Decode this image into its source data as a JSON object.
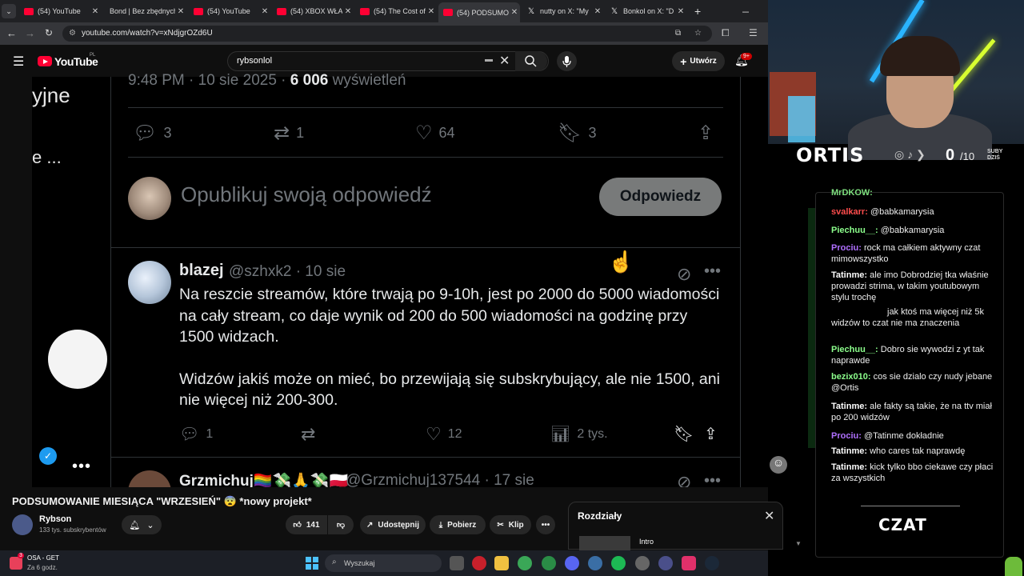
{
  "browser": {
    "tabs": [
      {
        "label": "(54) YouTube",
        "icon": "youtube-icon"
      },
      {
        "label": "Bond | Bez zbędnych",
        "icon": "none"
      },
      {
        "label": "(54) YouTube",
        "icon": "youtube-icon"
      },
      {
        "label": "(54) XBOX WŁA",
        "icon": "youtube-icon"
      },
      {
        "label": "(54) The Cost of",
        "icon": "youtube-icon"
      },
      {
        "label": "(54) PODSUMO",
        "icon": "youtube-icon",
        "active": true
      },
      {
        "label": "nutty on X: \"My",
        "icon": "x-icon"
      },
      {
        "label": "Bonkol on X: \"D",
        "icon": "x-icon"
      }
    ],
    "url": "youtube.com/watch?v=xNdjgrOZd6U",
    "new_tab": "+"
  },
  "youtube": {
    "logo_text": "YouTube",
    "logo_region": "PL",
    "search_value": "rybsonlol",
    "create_label": "Utwórz",
    "notifications_badge": "9+"
  },
  "video": {
    "left_text_1": "yjne",
    "left_text_2": "e ...",
    "left_dots": "•••",
    "tweet_date_line_prefix": "9:48 PM · 10 sie 2025 · ",
    "tweet_views_number": "6 006",
    "tweet_views_suffix": " wyświetleń",
    "stats": {
      "replies": "3",
      "reposts": "1",
      "likes": "64",
      "bookmarks": "3"
    },
    "reply_placeholder": "Opublikuj swoją odpowiedź",
    "reply_button": "Odpowiedz",
    "reply_tweet": {
      "name": "blazej",
      "handle": "@szhxk2 · 10 sie",
      "paragraph_1": "Na reszcie streamów, które trwają po 9-10h, jest po 2000 do 5000 wiadomości na cały stream, co daje wynik od 200 do 500 wiadomości na godzinę przy 1500 widzach.",
      "paragraph_2": "Widzów jakiś może on mieć, bo przewijają się subskrybujący, ale nie 1500, ani nie więcej niż 200-300.",
      "replies": "1",
      "likes": "12",
      "views": "2 tys."
    },
    "next_tweet": {
      "name": "Grzmichuj🏳️‍🌈💸🙏💸🇵🇱",
      "handle": "@Grzmichuj137544 · 17 sie"
    }
  },
  "below_video": {
    "title": "PODSUMOWANIE MIESIĄCA \"WRZESIEŃ\" 😨 *nowy projekt*",
    "channel_name": "Rybson",
    "channel_subs": "133 tys. subskrybentów",
    "likes": "141",
    "share_label": "Udostępnij",
    "download_label": "Pobierz",
    "clip_label": "Klip",
    "more": "•••"
  },
  "chapters": {
    "title": "Rozdziały",
    "first_item": "Intro"
  },
  "stream_overlay": {
    "streamer": "ORTIS",
    "sub_count": "0",
    "sub_goal": "/10",
    "sub_label_1": "SUBY",
    "sub_label_2": "DZIŚ",
    "chat_title": "CZAT",
    "messages": [
      {
        "user": "MrDKOW:",
        "text": "",
        "color": "#7ee07e"
      },
      {
        "user": "svalkarr:",
        "text": "@babkamarysia",
        "color": "#ff4d4d"
      },
      {
        "user": "Piechuu__:",
        "text": "@babkamarysia",
        "color": "#8cff8c"
      },
      {
        "user": "Prociu:",
        "text": "rock ma całkiem aktywny czat mimowszystko",
        "color": "#b070ff"
      },
      {
        "user": "Tatinme:",
        "text": "ale imo Dobrodziej tka właśnie prowadzi strima, w takim youtubowym stylu trochę",
        "color": "#ffffff"
      },
      {
        "user": "",
        "text": "jak ktoś ma więcej niż 5k widzów to czat nie ma znaczenia",
        "color": "#ffffff"
      },
      {
        "user": "Piechuu__:",
        "text": "Dobro sie wywodzi z yt tak naprawde",
        "color": "#8cff8c"
      },
      {
        "user": "bezix010:",
        "text": "cos sie dzialo czy nudy jebane @Ortis",
        "color": "#8cff8c"
      },
      {
        "user": "Tatinme:",
        "text": "ale fakty są takie, że na ttv miał po 200 widzów",
        "color": "#ffffff"
      },
      {
        "user": "Prociu:",
        "text": "@Tatinme dokładnie",
        "color": "#b070ff"
      },
      {
        "user": "Tatinme:",
        "text": "who cares tak naprawdę",
        "color": "#ffffff"
      },
      {
        "user": "Tatinme:",
        "text": "kick tylko bbo ciekawe czy płaci za wszystkich",
        "color": "#ffffff"
      }
    ]
  },
  "taskbar": {
    "notification_title": "OSA - GET",
    "notification_sub": "Za 6 godz.",
    "notification_badge": "3",
    "search_placeholder": "Wyszukaj"
  }
}
